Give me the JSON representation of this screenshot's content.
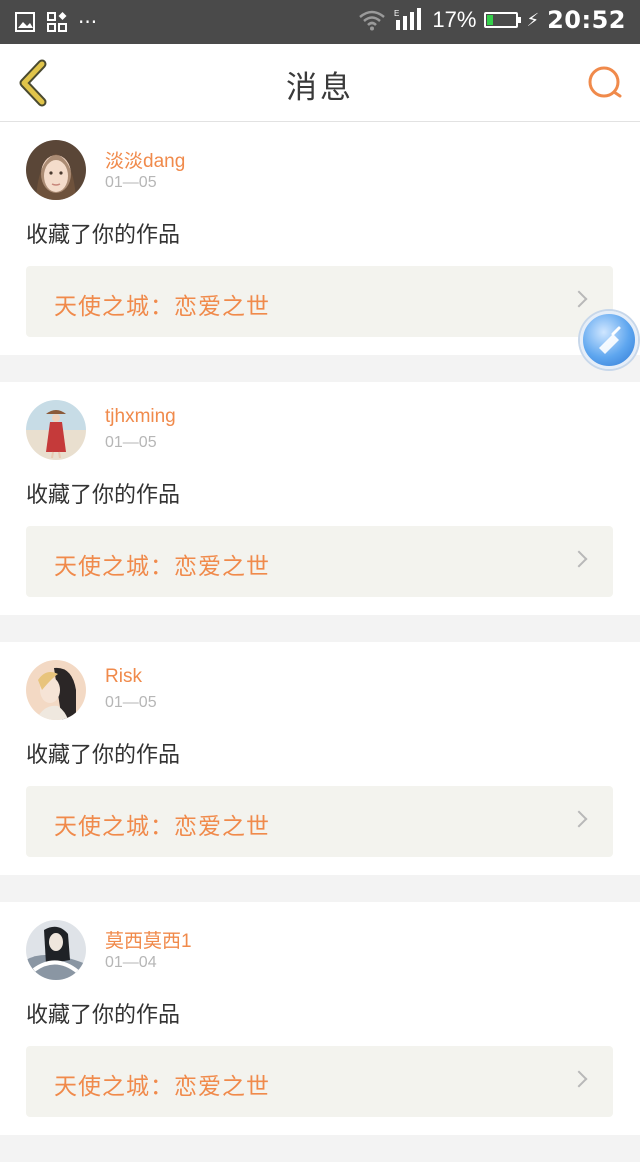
{
  "status_bar": {
    "time": "20:52",
    "battery_percent": "17%",
    "battery_level": 0.17,
    "overflow": "···",
    "icons": [
      "image-icon",
      "apps-icon",
      "wifi-icon",
      "signal-icon",
      "battery-icon",
      "charging-icon"
    ]
  },
  "header": {
    "title": "消息",
    "back_icon": "chevron-left-icon",
    "search_icon": "search-icon"
  },
  "colors": {
    "accent": "#f08a4b",
    "back_arrow": "#e0c44a",
    "work_box_bg": "#f3f3ee",
    "date_gray": "#b6b6b6"
  },
  "messages": [
    {
      "username": "淡淡dang",
      "date": "01—05",
      "action": "收藏了你的作品",
      "work_title": "天使之城：恋爱之世"
    },
    {
      "username": "tjhxming",
      "date": "01—05",
      "action": "收藏了你的作品",
      "work_title": "天使之城：恋爱之世"
    },
    {
      "username": "Risk",
      "date": "01—05",
      "action": "收藏了你的作品",
      "work_title": "天使之城：恋爱之世"
    },
    {
      "username": "莫西莫西1",
      "date": "01—04",
      "action": "收藏了你的作品",
      "work_title": "天使之城：恋爱之世"
    }
  ]
}
